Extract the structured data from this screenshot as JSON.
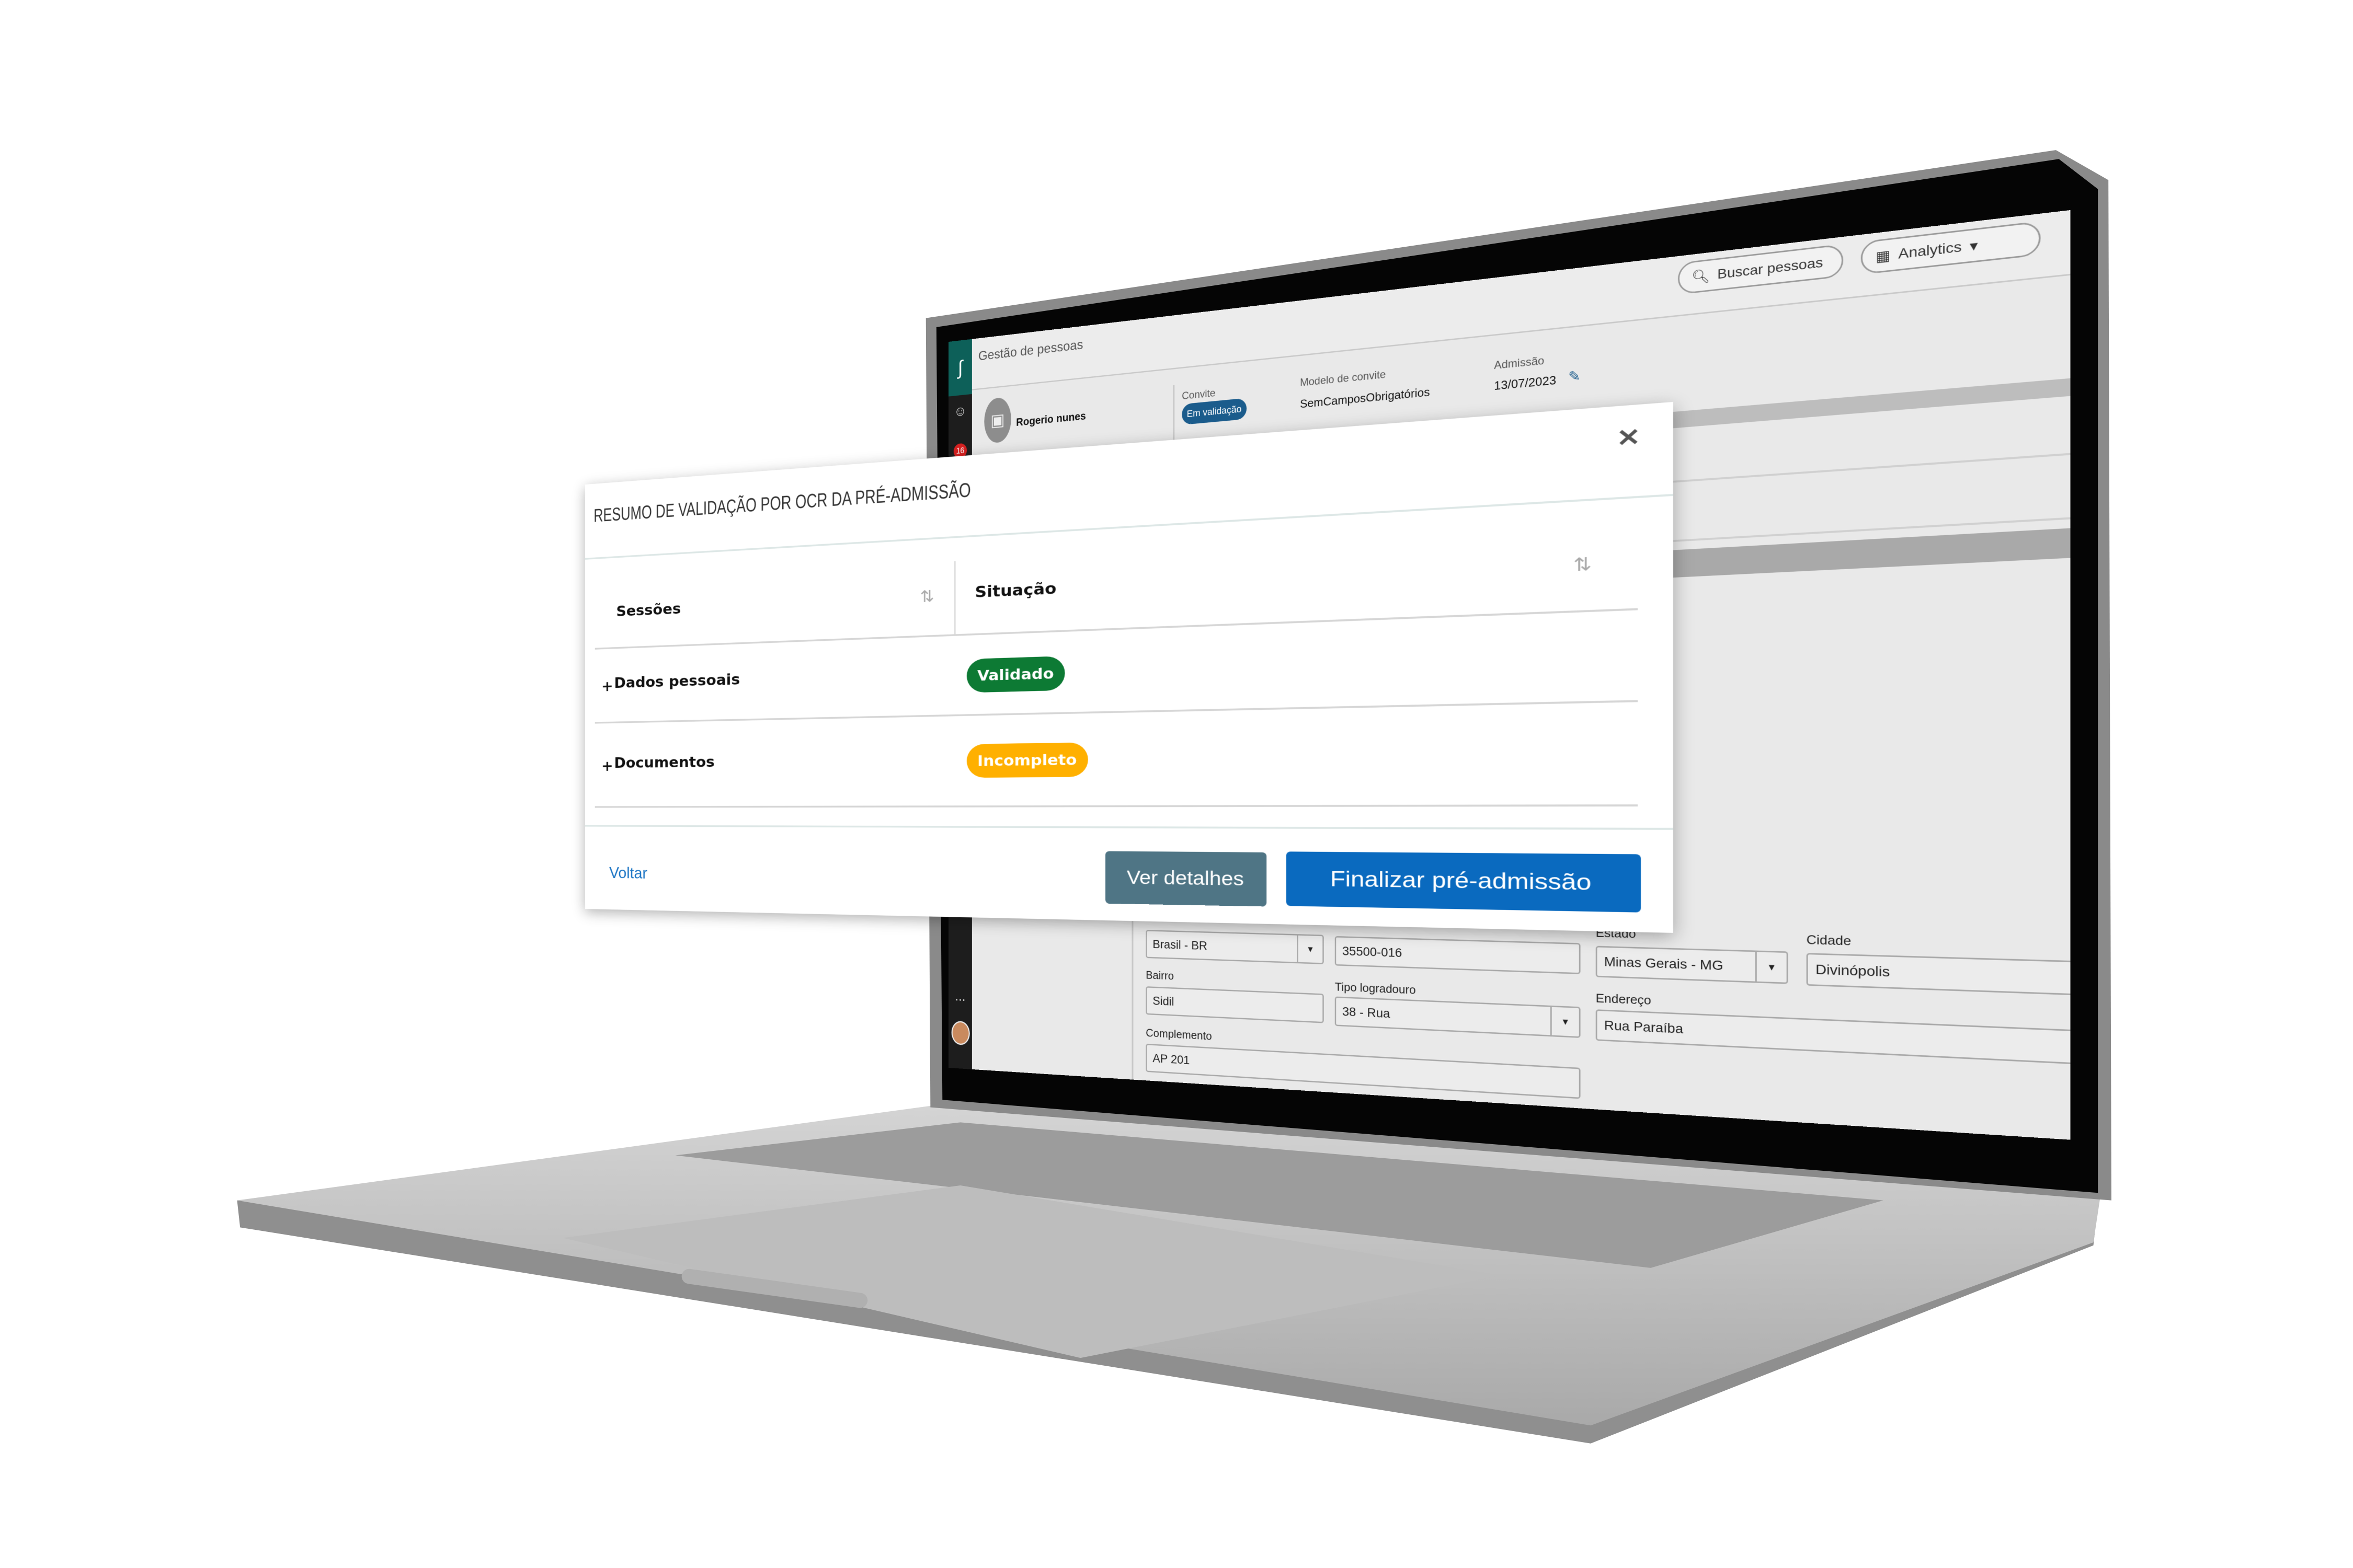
{
  "app": {
    "module_title": "Gestão de pessoas",
    "search_label": "Buscar pessoas",
    "analytics_label": "Analytics",
    "notification_count": "16",
    "sidebar_more": "..."
  },
  "profile": {
    "name": "Rogerio nunes",
    "convite_label": "Convite",
    "convite_status": "Em validação",
    "modelo_label": "Modelo de convite",
    "modelo_value": "SemCamposObrigatórios",
    "admissao_label": "Admissão",
    "admissao_value": "13/07/2023"
  },
  "form": {
    "pais_value": "Brasil - BR",
    "cep_value": "35500-016",
    "estado_label": "Estado",
    "estado_value": "Minas Gerais - MG",
    "cidade_label": "Cidade",
    "cidade_value": "Divinópolis",
    "bairro_label": "Bairro",
    "bairro_value": "Sidil",
    "tipo_label": "Tipo logradouro",
    "tipo_value": "38 - Rua",
    "endereco_label": "Endereço",
    "endereco_value": "Rua Paraíba",
    "complemento_label": "Complemento",
    "complemento_value": "AP 201"
  },
  "modal": {
    "title": "RESUMO DE VALIDAÇÃO POR OCR DA PRÉ-ADMISSÃO",
    "columns": [
      "Sessões",
      "Situação"
    ],
    "rows": [
      {
        "section": "Dados pessoais",
        "status": "Validado",
        "status_color": "#0d7a34"
      },
      {
        "section": "Documentos",
        "status": "Incompleto",
        "status_color": "#ffb000"
      }
    ],
    "back_label": "Voltar",
    "details_label": "Ver detalhes",
    "finish_label": "Finalizar pré-admissão"
  },
  "colors": {
    "primary": "#0a6abf",
    "secondary": "#4f7585",
    "link": "#1a74c4",
    "brand": "#0d6059"
  }
}
